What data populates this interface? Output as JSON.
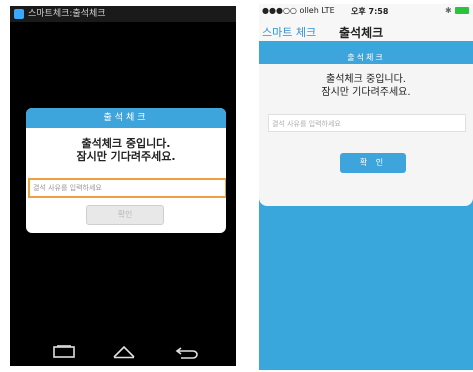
{
  "android": {
    "status_title": "스마트체크:출석체크",
    "dialog": {
      "header": "출석체크",
      "message_line1": "출석체크 중입니다.",
      "message_line2": "잠시만 기다려주세요.",
      "input_placeholder": "결석 사유를 입력하세요",
      "confirm_label": "확인"
    },
    "nav": [
      "recent-apps-icon",
      "home-icon",
      "back-icon"
    ]
  },
  "iphone": {
    "status": {
      "carrier": "●●●○○ olleh  LTE",
      "time": "오후 7:58",
      "bluetooth_icon": "bluetooth-icon",
      "battery_icon": "battery-icon"
    },
    "nav": {
      "back_label": "스마트 체크",
      "title": "출석체크"
    },
    "dialog": {
      "header": "출석체크",
      "message_line1": "출석체크 중입니다.",
      "message_line2": "잠시만 기다려주세요.",
      "input_placeholder": "결석 사유를 입력하세요",
      "confirm_label": "확 인"
    }
  },
  "colors": {
    "accent": "#3ea5dc",
    "input_focus": "#f0a040",
    "battery": "#29c43b"
  }
}
